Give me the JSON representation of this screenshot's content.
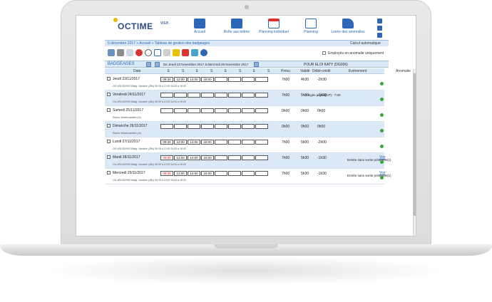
{
  "app": {
    "logo": "OCTIME",
    "logo_suffix": "WEB"
  },
  "nav": [
    {
      "label": "Accueil",
      "icon": "home-icon"
    },
    {
      "label": "Boîte aux lettres",
      "icon": "mailbox-icon"
    },
    {
      "label": "Planning individuel",
      "icon": "calendar-365-icon"
    },
    {
      "label": "Planning",
      "icon": "calendar-icon"
    },
    {
      "label": "Levée des anomalies",
      "icon": "pen-icon"
    }
  ],
  "breadcrumb": {
    "date": "5 décembre 2017",
    "path": "» Accueil » Tableau de gestion des badgeages"
  },
  "calc_auto": "Calcul automatique",
  "toolbar": {
    "anomaly_only_label": "Employés en anomalie uniquement"
  },
  "badgeages": {
    "title": "BADGEAGES",
    "range": "De Jeudi 23 Novembre 2017 à Mercredi 29 Novembre 2017",
    "person": "POUR ELOI KATY (DG006)"
  },
  "columns": {
    "date": "Date",
    "e": "E",
    "s": "S",
    "prevu": "Prévu",
    "valide": "Validé",
    "debit": "Débit-crédit",
    "evenement": "Evénement",
    "anomalie": "Anomalie"
  },
  "rows": [
    {
      "date": "Jeudi 23/11/2017",
      "sub": "OG-6RU30/HS0 Batig. Variable (JBx) 09:30 à 12:00 16:00 à 18:00",
      "cells": [
        "09:30",
        "12:00",
        "14:00",
        "18:00",
        "",
        "",
        "",
        ""
      ],
      "red": [],
      "prevu": "7h00",
      "valide": "4h30",
      "debit": "-2h30",
      "event": "",
      "anomaly": "",
      "voir": false,
      "alt": false
    },
    {
      "date": "Vendredi 24/11/2017",
      "sub": "OG-6RU30/HS0 Batig. Variable (JBx) 09:30 à 12:00 14:00 à 18:00",
      "cells": [
        "",
        "",
        "",
        "",
        "",
        "",
        "",
        ""
      ],
      "red": [],
      "prevu": "7h00",
      "valide": "5h30",
      "debit": "-1h30",
      "event": "Congés payés(CP) : 7:00",
      "anomaly": "",
      "voir": false,
      "alt": true
    },
    {
      "date": "Samedi 25/11/2017",
      "sub": "Repos hebdomadaire (rh)",
      "cells": [
        "",
        "",
        "",
        "",
        "",
        "",
        "",
        ""
      ],
      "red": [],
      "prevu": "0h00",
      "valide": "0h00",
      "debit": "0h00",
      "event": "",
      "anomaly": "",
      "voir": false,
      "alt": false
    },
    {
      "date": "Dimanche 26/11/2017",
      "sub": "Repos hebdomadaire (rh)",
      "cells": [
        "",
        "",
        "",
        "",
        "",
        "",
        "",
        ""
      ],
      "red": [],
      "prevu": "0h00",
      "valide": "0h00",
      "debit": "0h00",
      "event": "",
      "anomaly": "",
      "voir": false,
      "alt": true
    },
    {
      "date": "Lundi 27/11/2017",
      "sub": "OG-6RU30/HS0 Batig. Variable (JBx) 09:30 à 12:00 14:00 à 18:00",
      "cells": [
        "09:30",
        "12:00",
        "14:00",
        "16:00",
        "",
        "",
        "",
        ""
      ],
      "red": [],
      "prevu": "7h00",
      "valide": "5h00",
      "debit": "-2h00",
      "event": "",
      "anomaly": "",
      "voir": false,
      "alt": false
    },
    {
      "date": "Mardi 28/11/2017",
      "sub": "OG-6RU30/HS0 Batig. Variable (JBx) 09:30 à 12:00 14:00 à 18:00",
      "cells": [
        "09:30",
        "12:00",
        "14:00",
        "16:00",
        "",
        "",
        "",
        ""
      ],
      "red": [
        0
      ],
      "prevu": "7h00",
      "valide": "5h30",
      "debit": "-1h30",
      "event": "",
      "anomaly": "Entrée sans sortie préalable(1)",
      "voir": true,
      "alt": true
    },
    {
      "date": "Mercredi 29/11/2017",
      "sub": "OG-6RU30/HS0 Batig. Variable (JBx) 09:30 à 12:00 14:00 à 18:00",
      "cells": [
        "09:30",
        "12:00",
        "14:00",
        "16:00",
        "",
        "",
        "",
        ""
      ],
      "red": [
        0
      ],
      "prevu": "7h00",
      "valide": "5h30",
      "debit": "-1h30",
      "event": "",
      "anomaly": "Entrée sans sortie préalable(1)",
      "voir": true,
      "alt": false
    }
  ],
  "voir_label": "Voir"
}
